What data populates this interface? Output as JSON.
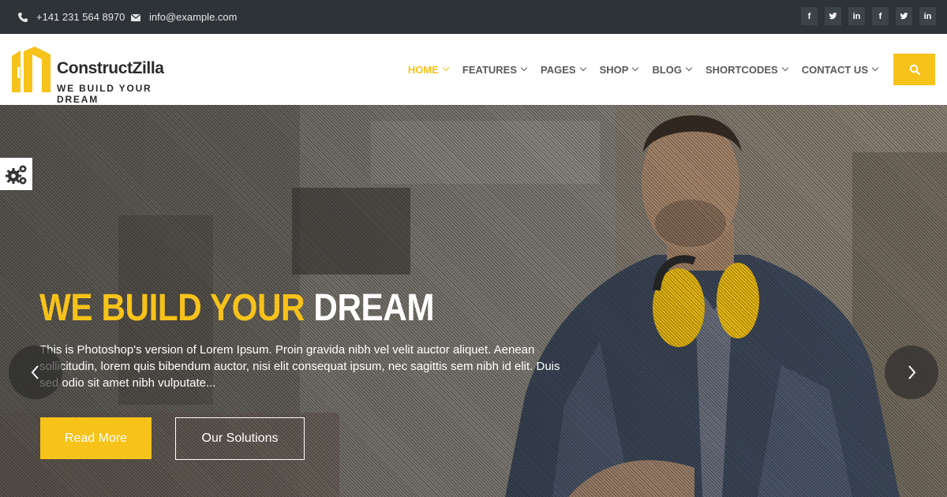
{
  "topbar": {
    "phone": "+141 231 564 8970",
    "email": "info@example.com",
    "phone_icon": "phone-icon",
    "email_icon": "envelope-icon",
    "social_links": [
      {
        "icon": "facebook-icon",
        "label": "f"
      },
      {
        "icon": "twitter-icon",
        "label": ""
      },
      {
        "icon": "linkedin-icon",
        "label": "in"
      },
      {
        "icon": "facebook-icon",
        "label": "f"
      },
      {
        "icon": "twitter-icon",
        "label": ""
      },
      {
        "icon": "linkedin-icon",
        "label": "in"
      }
    ]
  },
  "header": {
    "logo_name": "ConstructZilla",
    "logo_tagline": "WE BUILD YOUR DREAM",
    "nav": [
      {
        "label": "HOME",
        "active": true
      },
      {
        "label": "FEATURES",
        "active": false
      },
      {
        "label": "PAGES",
        "active": false
      },
      {
        "label": "SHOP",
        "active": false
      },
      {
        "label": "BLOG",
        "active": false
      },
      {
        "label": "SHORTCODES",
        "active": false
      },
      {
        "label": "CONTACT US",
        "active": false
      }
    ],
    "search_icon": "search-icon"
  },
  "hero": {
    "title_highlight": "WE BUILD YOUR",
    "title_rest": "DREAM",
    "text": "This is Photoshop's version of Lorem Ipsum. Proin gravida nibh vel velit auctor aliquet. Aenean sollicitudin, lorem quis bibendum auctor, nisi elit consequat ipsum, nec sagittis sem nibh id elit. Duis sed odio sit amet nibh vulputate...",
    "primary_button": "Read More",
    "secondary_button": "Our Solutions",
    "prev_icon": "chevron-left-icon",
    "next_icon": "chevron-right-icon",
    "settings_icon": "gears-icon"
  },
  "colors": {
    "accent": "#f7c21a",
    "topbar_bg": "#2e3338",
    "nav_text": "#5a5a5a",
    "text_dark": "#2a2a2a"
  }
}
